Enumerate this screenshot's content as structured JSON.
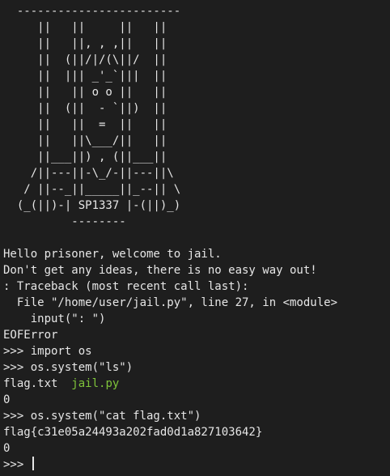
{
  "banner_art": "  ------------------------\n     ||   ||     ||   ||\n     ||   ||, , ,||   ||\n     ||  (||/|/(\\||/  ||\n     ||  ||| _'_`|||  ||\n     ||   || o o ||   ||\n     ||  (||  - `||)  ||\n     ||   ||  =  ||   ||\n     ||   ||\\___/||   ||\n     ||___||) , (||___||\n    /||---||-\\_/-||---||\\\n   / ||--_||_____||_--|| \\\n  (_(||)-| SP1337 |-(||)_)\n          --------",
  "session": {
    "welcome": "Hello prisoner, welcome to jail.",
    "warning": "Don't get any ideas, there is no easy way out!",
    "traceback_header": ": Traceback (most recent call last):",
    "traceback_file": "  File \"/home/user/jail.py\", line 27, in <module>",
    "traceback_code": "    input(\": \")",
    "error": "EOFError",
    "cmd_import": ">>> import os",
    "cmd_ls": ">>> os.system(\"ls\")",
    "ls_file1": "flag.txt",
    "ls_sep": "  ",
    "ls_file2": "jail.py",
    "ret1": "0",
    "cmd_cat": ">>> os.system(\"cat flag.txt\")",
    "flag_output": "flag{c31e05a24493a202fad0d1a827103642}",
    "ret2": "0",
    "prompt": ">>> "
  },
  "colors": {
    "background": "#1e1e1e",
    "foreground": "#e6e6e6",
    "python_file": "#7ec33a"
  }
}
